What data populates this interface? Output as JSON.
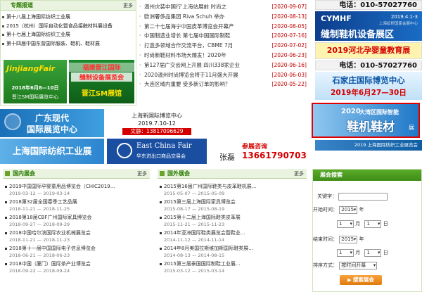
{
  "top_left": {
    "title": "专题报道",
    "more": "更多",
    "items": [
      "第十八届上海国际纺织工业展",
      "2015（杭州）国际自动化暨食品接触材料展设备",
      "第十七届上海国际纺织工业展",
      "第十四届中国东营国际服装、鞋机、鞋材展"
    ],
    "banner_jinjiang": {
      "title": "JinjiangFair",
      "date": "2018年6月8—10日",
      "venue": "晋江SM国际展览中心"
    },
    "banner_jinjiang2": {
      "line1": "福建晋江国际",
      "line2": "缝制设备展览会",
      "venue": "晋江SM展馆"
    }
  },
  "news": [
    {
      "t": "温州灾装中国行'上海站展前 时尚之",
      "d": "[2020-09-07]"
    },
    {
      "t": "欧洲奢侈品集团 Riva Schuh 举办",
      "d": "[2020-08-13]"
    },
    {
      "t": "第二十七届海宁中国皮革博览会开幕产",
      "d": "[2020-08-05]"
    },
    {
      "t": "中国制造业增长 第七届中国国际制鞋",
      "d": "[2020-07-16]"
    },
    {
      "t": "打造多领域合作交流平台，CBME 7月",
      "d": "[2020-07-02]"
    },
    {
      "t": "时尚新鞋材料市场大爆发！2020年",
      "d": "[2020-06-23]"
    },
    {
      "t": "第127届广交会网上开展 四川338家企业",
      "d": "[2020-06-16]"
    },
    {
      "t": "2020温州时尚博览会将于11月盛大开展",
      "d": "[2020-06-03]"
    },
    {
      "t": "大连区域内重要 受多新订单的影响？",
      "d": "[2020-05-22]"
    }
  ],
  "right_banners": {
    "ad1_phone": "电话：010-57027760",
    "ad2_brand": "CYMHF",
    "ad2_date": "2019.4.1-3",
    "ad2_venue": "上海虹桥国家会展中心",
    "ad2_title": "缝制鞋机设备展区",
    "ad3": "2019河北孕婴童教育展",
    "ad3_phone": "电话：010-57027760",
    "ad4_title": "石家庄国际博览中心",
    "ad4_date": "2019年6月27—30日"
  },
  "middle_banners": {
    "gd_title1": "广东现代",
    "gd_title2": "国际展览中心",
    "shtex": "上海国际纺织工业展",
    "sh_center": "上海新国际博览中心",
    "sh_date": "2019.7.10-12",
    "sh_contact": "文静：13817096629",
    "ecf_title": "East China Fair",
    "ecf_sub": "华东进出口商品交易会",
    "zx_title": "参展咨询",
    "zx_name": "张磊",
    "zx_phone": "13661790703",
    "dq_year": "2020",
    "dq_title": "大湾区国际智能",
    "dq_main": "鞋机鞋材",
    "dq_suffix": "展",
    "dq_bottom": "2019 上海国际纺织工业展览会"
  },
  "domestic": {
    "title": "国内展会",
    "more": "更多",
    "items": [
      {
        "t": "2019中国国际孕婴童用品博览会（CHIC2019...",
        "d": "2019-03-12 — 2019-03-14"
      },
      {
        "t": "2018第32届全国春季工艺品展",
        "d": "2018-11-21 — 2018-11-25"
      },
      {
        "t": "2018第18届CBF广州国际家具博览会",
        "d": "2018-09-27 — 2018-09-29"
      },
      {
        "t": "2018中国哈尔滨国际农业机械展览会",
        "d": "2018-11-21 — 2018-11-23"
      },
      {
        "t": "2018第十一届中国国际电子信息博览会",
        "d": "2018-06-21 — 2018-06-23"
      },
      {
        "t": "2018中国（厦门）国际茶产业博览会",
        "d": "2018-09-22 — 2018-09-24"
      }
    ]
  },
  "foreign": {
    "title": "国外展会",
    "more": "更多",
    "items": [
      {
        "t": "2015第16届广州国际鞋类与皮革鞋机展...",
        "d": "2015-05-07 — 2015-05-09"
      },
      {
        "t": "2015第三届上海国际家具博览会",
        "d": "2015-08-17 — 2015-08-19"
      },
      {
        "t": "2015第十二届上海国际鞋类皮革展",
        "d": "2015-11-21 — 2015-11-23"
      },
      {
        "t": "2014年亚洲国际鞋类展览会暨鞋业...",
        "d": "2014-11-12 — 2014-11-14"
      },
      {
        "t": "2014年8月美国拉斯维加斯国际鞋类展...",
        "d": "2014-08-13 — 2014-08-15"
      },
      {
        "t": "2015第三届泰国国际制鞋工业展...",
        "d": "2015-03-12 — 2015-03-14"
      }
    ]
  },
  "search": {
    "title": "展会搜索",
    "keyword_label": "关键字：",
    "start_label": "开始时间：",
    "end_label": "结束时间：",
    "sort_label": "排序方式：",
    "year": "2015",
    "month": "1",
    "day": "1",
    "sort": "按时间开幕",
    "submit": "搜索展会",
    "year_unit": "年",
    "month_unit": "月",
    "day_unit": "日"
  },
  "colors": {
    "green": "#2a7a00",
    "red": "#d40000",
    "blue": "#0b57a8"
  }
}
